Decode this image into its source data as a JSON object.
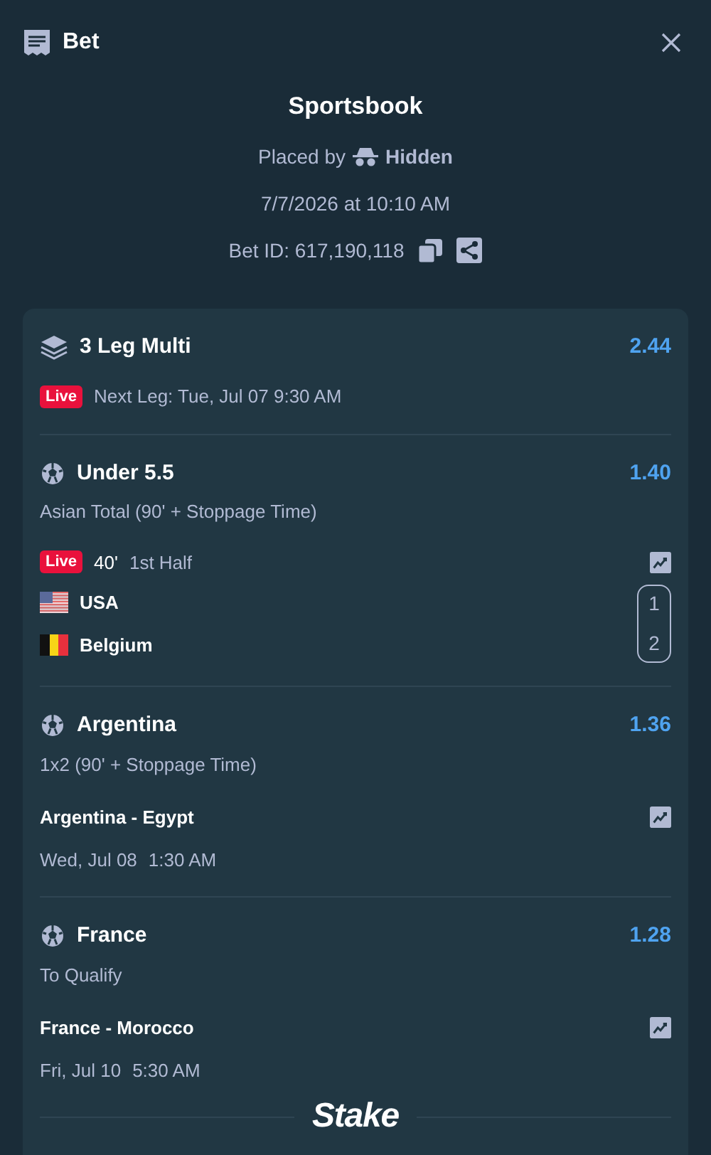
{
  "header": {
    "title": "Bet"
  },
  "summary": {
    "title": "Sportsbook",
    "placed_by_label": "Placed by",
    "placed_by_user": "Hidden",
    "datetime": "7/7/2026 at 10:10 AM",
    "bet_id": "Bet ID: 617,190,118"
  },
  "multi": {
    "title": "3 Leg Multi",
    "odds": "2.44",
    "live_badge": "Live",
    "next_leg": "Next Leg: Tue, Jul 07 9:30 AM"
  },
  "legs": [
    {
      "kind": "live",
      "selection": "Under 5.5",
      "odds": "1.40",
      "market": "Asian Total (90' + Stoppage Time)",
      "live_badge": "Live",
      "minute": "40'",
      "period": "1st Half",
      "teams": [
        {
          "name": "USA",
          "kind": "us",
          "score": "1"
        },
        {
          "name": "Belgium",
          "kind": "be",
          "score": "2"
        }
      ]
    },
    {
      "kind": "scheduled",
      "selection": "Argentina",
      "odds": "1.36",
      "market": "1x2 (90' + Stoppage Time)",
      "match": "Argentina - Egypt",
      "date": "Wed, Jul 08",
      "time": "1:30 AM"
    },
    {
      "kind": "scheduled",
      "selection": "France",
      "odds": "1.28",
      "market": "To Qualify",
      "match": "France - Morocco",
      "date": "Fri, Jul 10",
      "time": "5:30 AM"
    }
  ],
  "footer": {
    "logo": "Stake"
  }
}
